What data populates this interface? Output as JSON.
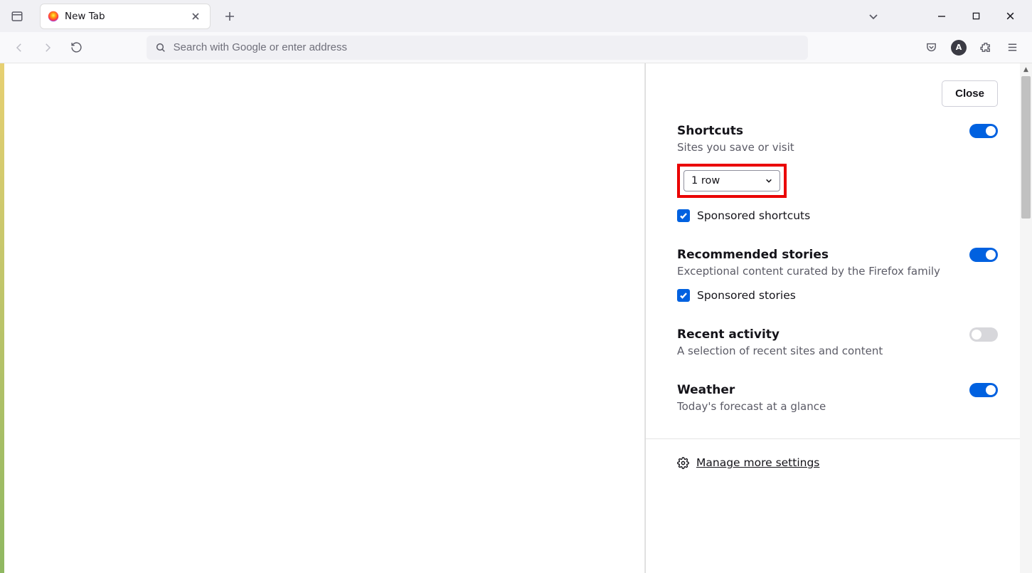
{
  "tab": {
    "title": "New Tab"
  },
  "urlbar": {
    "placeholder": "Search with Google or enter address"
  },
  "account": {
    "initial": "A"
  },
  "panel": {
    "close_label": "Close",
    "shortcuts": {
      "title": "Shortcuts",
      "caption": "Sites you save or visit",
      "select_value": "1 row",
      "sponsored_label": "Sponsored shortcuts"
    },
    "stories": {
      "title": "Recommended stories",
      "caption": "Exceptional content curated by the Firefox family",
      "sponsored_label": "Sponsored stories"
    },
    "activity": {
      "title": "Recent activity",
      "caption": "A selection of recent sites and content"
    },
    "weather": {
      "title": "Weather",
      "caption": "Today's forecast at a glance"
    },
    "manage_label": "Manage more settings"
  }
}
